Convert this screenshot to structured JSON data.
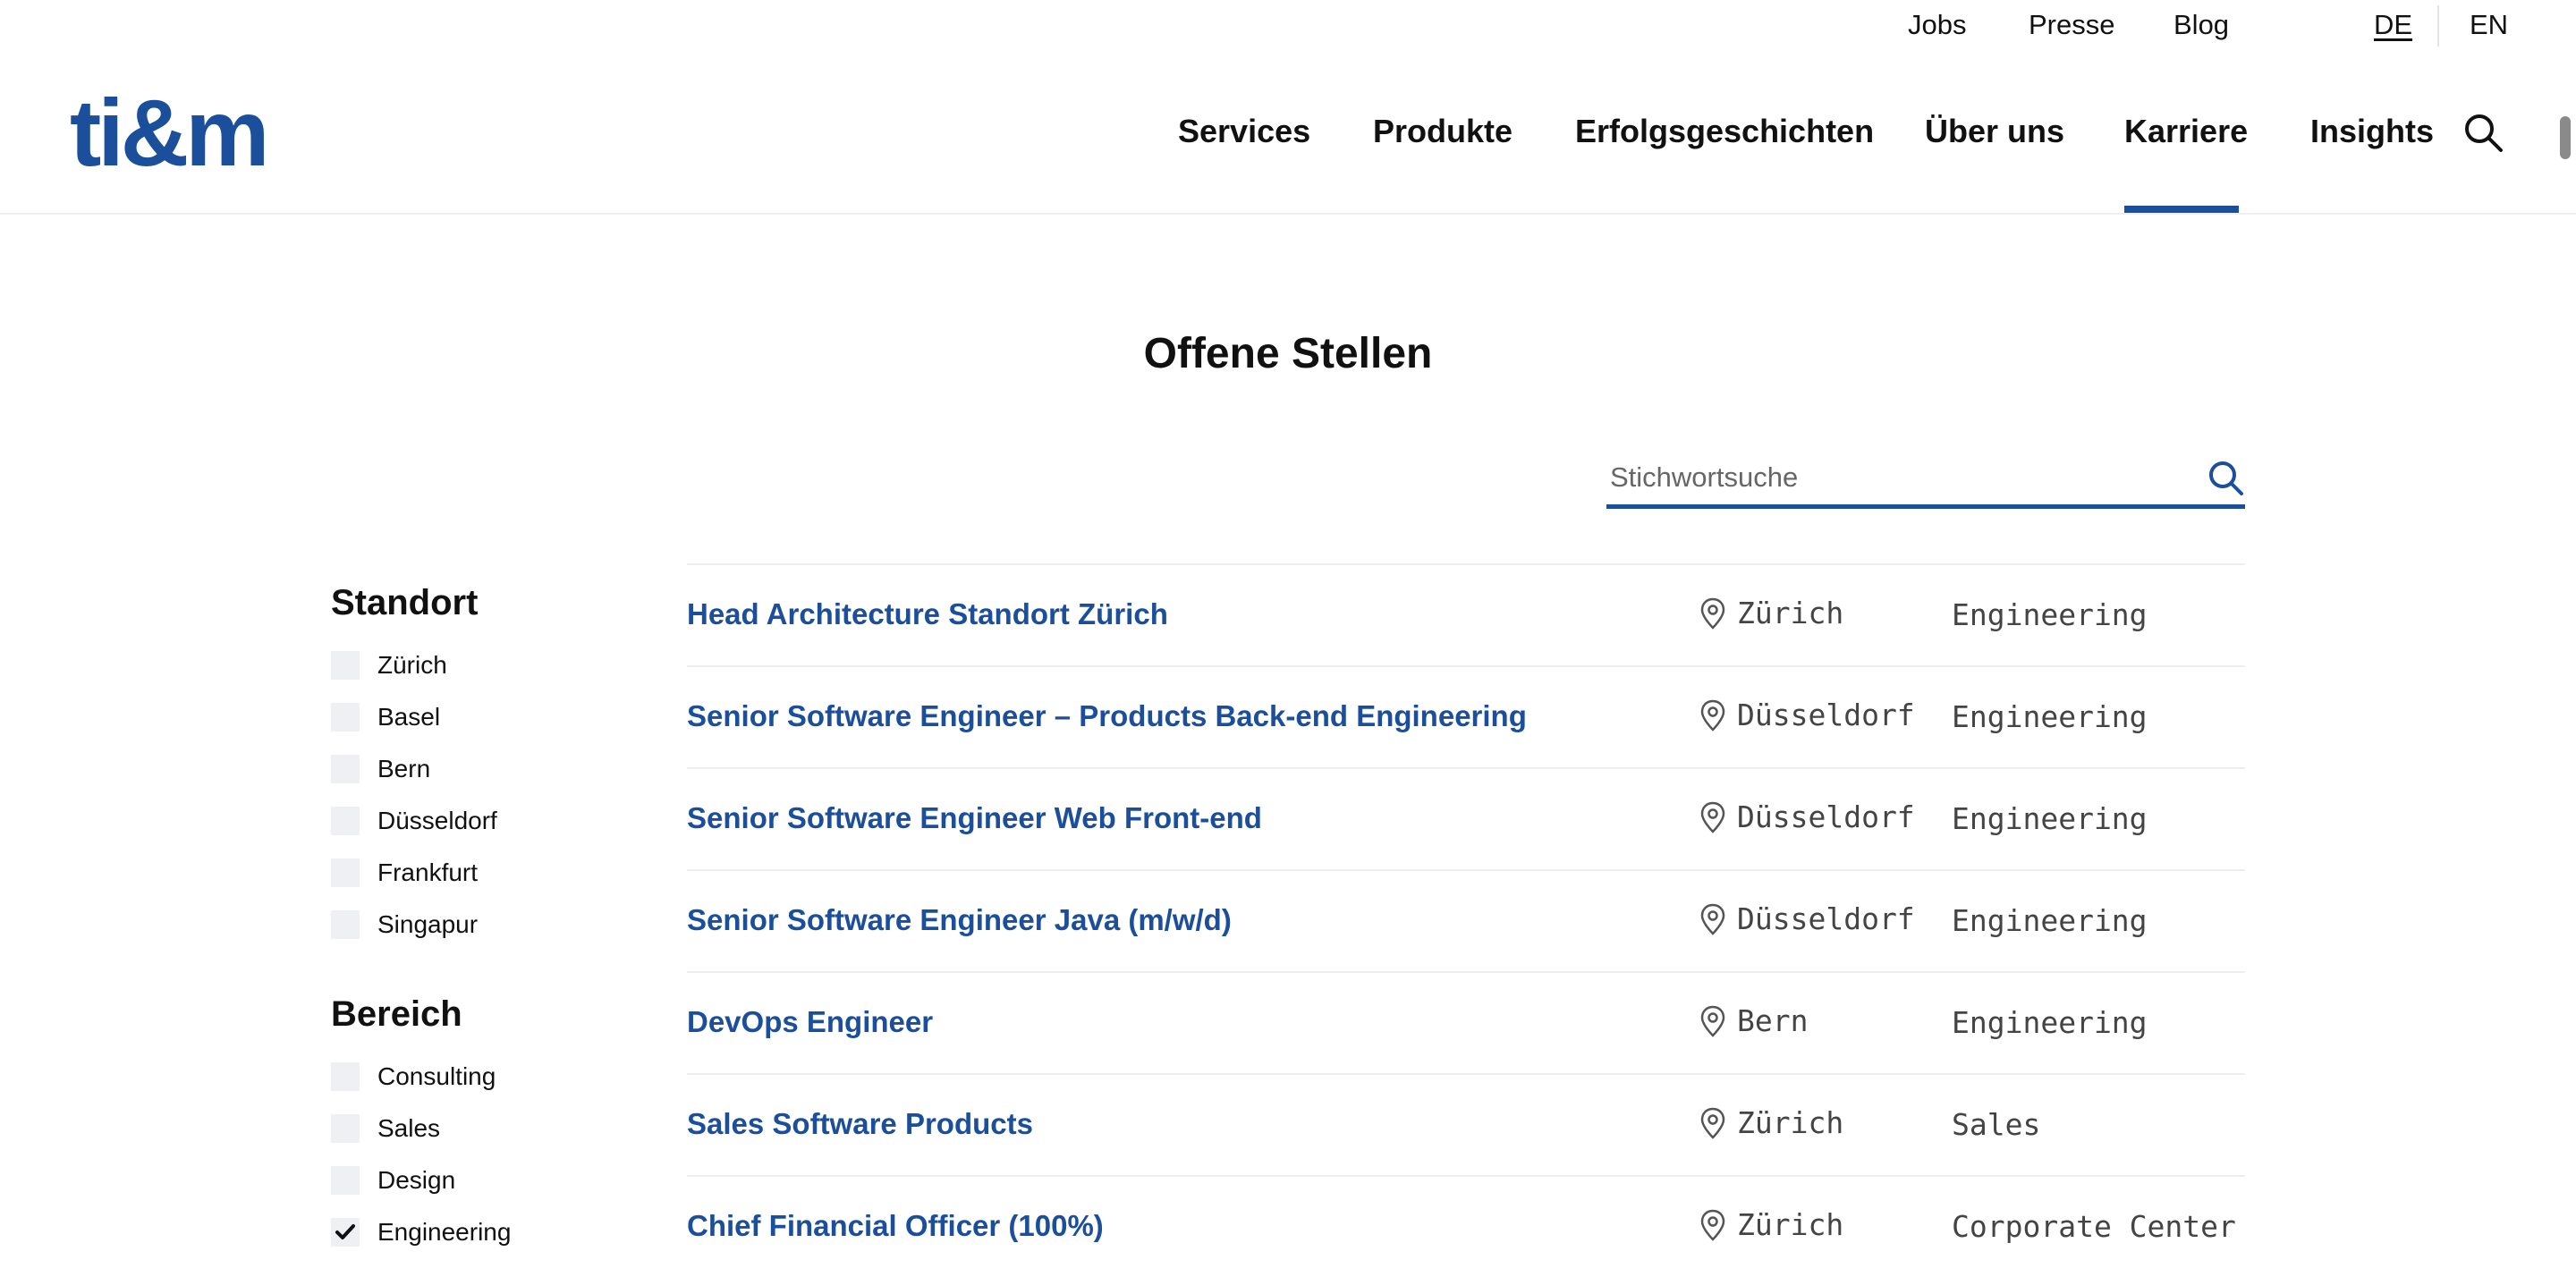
{
  "utility": {
    "links": [
      "Jobs",
      "Presse",
      "Blog"
    ],
    "languages": [
      {
        "label": "DE",
        "active": true
      },
      {
        "label": "EN",
        "active": false
      }
    ]
  },
  "header": {
    "logo": "ti&m",
    "nav": [
      "Services",
      "Produkte",
      "Erfolgsgeschichten",
      "Über uns",
      "Karriere",
      "Insights"
    ],
    "active_nav": "Karriere",
    "search_icon": "search-icon"
  },
  "main": {
    "title": "Offene Stellen",
    "search": {
      "placeholder": "Stichwortsuche",
      "value": ""
    }
  },
  "filters": {
    "standort": {
      "heading": "Standort",
      "options": [
        {
          "label": "Zürich",
          "checked": false
        },
        {
          "label": "Basel",
          "checked": false
        },
        {
          "label": "Bern",
          "checked": false
        },
        {
          "label": "Düsseldorf",
          "checked": false
        },
        {
          "label": "Frankfurt",
          "checked": false
        },
        {
          "label": "Singapur",
          "checked": false
        }
      ]
    },
    "bereich": {
      "heading": "Bereich",
      "options": [
        {
          "label": "Consulting",
          "checked": false
        },
        {
          "label": "Sales",
          "checked": false
        },
        {
          "label": "Design",
          "checked": false
        },
        {
          "label": "Engineering",
          "checked": true
        }
      ]
    }
  },
  "jobs": [
    {
      "title": "Head Architecture Standort Zürich",
      "location": "Zürich",
      "area": "Engineering"
    },
    {
      "title": "Senior Software Engineer – Products Back-end Engineering",
      "location": "Düsseldorf",
      "area": "Engineering"
    },
    {
      "title": "Senior Software Engineer Web Front-end",
      "location": "Düsseldorf",
      "area": "Engineering"
    },
    {
      "title": "Senior Software Engineer Java (m/w/d)",
      "location": "Düsseldorf",
      "area": "Engineering"
    },
    {
      "title": "DevOps Engineer",
      "location": "Bern",
      "area": "Engineering"
    },
    {
      "title": "Sales Software Products",
      "location": "Zürich",
      "area": "Sales"
    },
    {
      "title": "Chief Financial Officer (100%)",
      "location": "Zürich",
      "area": "Corporate Center"
    }
  ],
  "colors": {
    "brand": "#1b4e9b",
    "checkbox_bg": "#eef0f3",
    "divider": "#eceef1"
  }
}
